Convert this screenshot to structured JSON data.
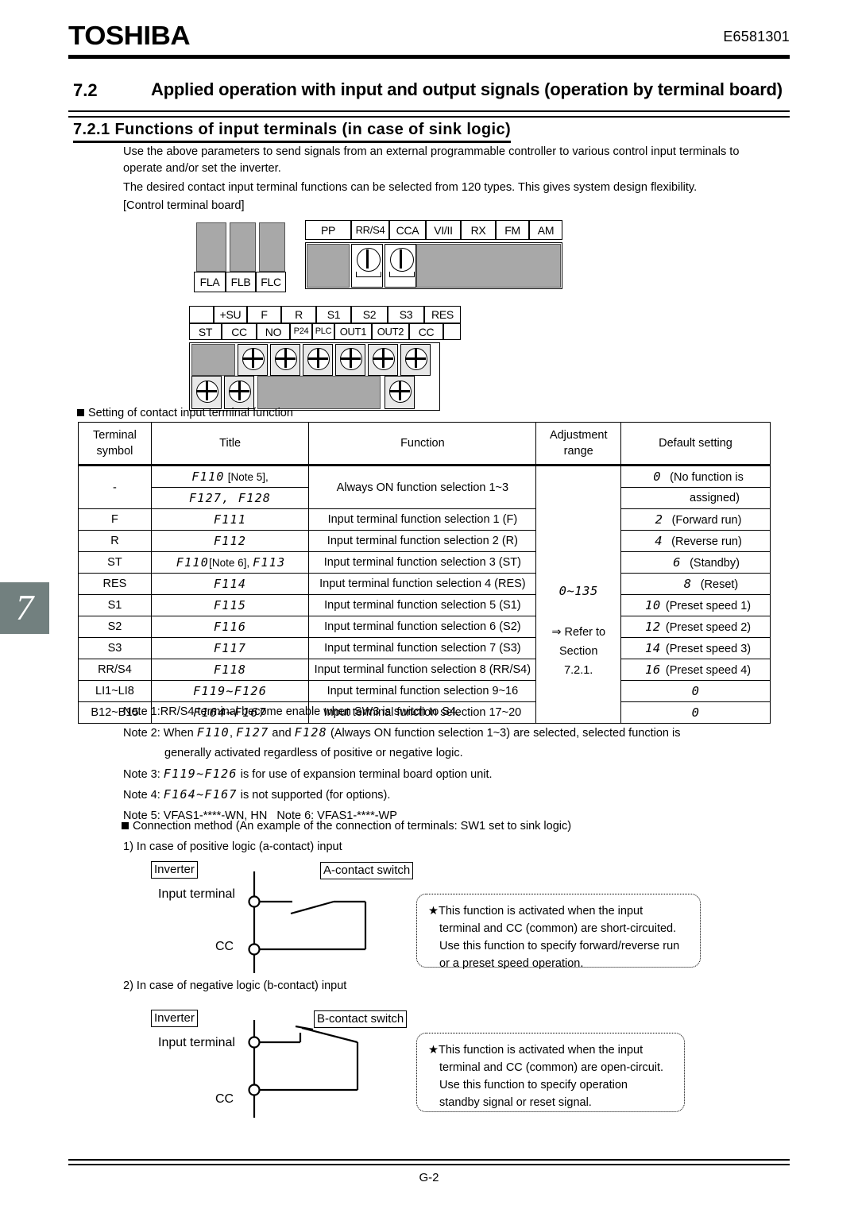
{
  "header": {
    "brand": "TOSHIBA",
    "doc_code": "E6581301"
  },
  "section": {
    "number": "7.2",
    "title": "Applied operation with input and output signals (operation by terminal board)",
    "subsection": "7.2.1  Functions of input terminals (in case of sink logic)"
  },
  "intro": {
    "p1": "Use the above parameters to send signals from an external programmable controller to various control input terminals to operate and/or set the inverter.",
    "p2": "The desired contact input terminal functions can be selected from 120 types. This gives system design flexibility.",
    "p3": "[Control terminal board]"
  },
  "chapter_thumb": "7",
  "terminal_board": {
    "relay_labels": [
      "FLA",
      "FLB",
      "FLC"
    ],
    "top_row_labels": [
      "PP",
      "RR/S4",
      "CCA",
      "VI/II",
      "RX",
      "FM",
      "AM"
    ],
    "mid_row_labels": [
      "",
      "+SU",
      "F",
      "R",
      "S1",
      "S2",
      "S3",
      "RES"
    ],
    "bottom_row_labels": [
      "ST",
      "CC",
      "NO",
      "P24",
      "PLC",
      "OUT1",
      "OUT2",
      "CC",
      ""
    ]
  },
  "table": {
    "caption": "Setting of contact input terminal function",
    "columns": {
      "symbol": [
        "Terminal",
        "symbol"
      ],
      "title": "Title",
      "function": "Function",
      "adjustment": [
        "Adjustment",
        "range"
      ],
      "default": "Default setting"
    },
    "adjust_range": {
      "range": "0~135",
      "refer": "⇒ Refer to",
      "section_word": "Section",
      "section_num": "7.2.1."
    },
    "rows": [
      {
        "symbol": "-",
        "title_line1": "F110",
        "title_note1": "[Note 5],",
        "title_line2": "F127, F128",
        "function": "Always ON function selection 1~3",
        "default_val": "0",
        "default_text": "(No function is",
        "default_text2": "assigned)"
      },
      {
        "symbol": "F",
        "title_line1": "F111",
        "function": "Input terminal function selection 1 (F)",
        "default_val": "2",
        "default_text": "(Forward run)"
      },
      {
        "symbol": "R",
        "title_line1": "F112",
        "function": "Input terminal function selection 2 (R)",
        "default_val": "4",
        "default_text": "(Reverse run)"
      },
      {
        "symbol": "ST",
        "title_line1": "F110",
        "title_note1": "[Note 6],",
        "title_extra": "F113",
        "function": "Input terminal function selection 3 (ST)",
        "default_val": "6",
        "default_text": "(Standby)"
      },
      {
        "symbol": "RES",
        "title_line1": "F114",
        "function": "Input terminal function selection 4 (RES)",
        "default_val": "8",
        "default_text": "(Reset)"
      },
      {
        "symbol": "S1",
        "title_line1": "F115",
        "function": "Input terminal function selection 5 (S1)",
        "default_val": "10",
        "default_text": "(Preset speed 1)"
      },
      {
        "symbol": "S2",
        "title_line1": "F116",
        "function": "Input terminal function selection 6 (S2)",
        "default_val": "12",
        "default_text": "(Preset speed 2)"
      },
      {
        "symbol": "S3",
        "title_line1": "F117",
        "function": "Input terminal function selection 7 (S3)",
        "default_val": "14",
        "default_text": "(Preset speed 3)"
      },
      {
        "symbol": "RR/S4",
        "title_line1": "F118",
        "function": "Input terminal function selection 8 (RR/S4)",
        "default_val": "16",
        "default_text": "(Preset speed 4)"
      },
      {
        "symbol": "LI1~LI8",
        "title_line1": "F119~F126",
        "function": "Input terminal function selection 9~16",
        "default_val": "0",
        "default_text": ""
      },
      {
        "symbol": "B12~B15",
        "title_line1": "F164~F167",
        "function": "Input terminal function selection 17~20",
        "default_val": "0",
        "default_text": ""
      }
    ]
  },
  "notes": {
    "n1": "Note 1:RR/S4 terminal become enable when SW3 is switch to S4.",
    "n2_a": "Note 2: When ",
    "n2_code1": "F110",
    "n2_b": ", ",
    "n2_code2": "F127",
    "n2_c": " and ",
    "n2_code3": "F128",
    "n2_d": " (Always ON function selection 1~3) are selected, selected function is",
    "n2_cont": "generally activated regardless of positive or negative logic.",
    "n3_a": "Note 3: ",
    "n3_code": "F119~F126",
    "n3_b": " is for use of expansion terminal board option unit.",
    "n4_a": "Note 4: ",
    "n4_code": "F164~F167",
    "n4_b": " is not supported (for options).",
    "n5": "Note 5: VFAS1-****-WN, HN",
    "n6": "Note 6: VFAS1-****-WP"
  },
  "connection": {
    "heading": "Connection method (An example of the connection of terminals: SW1 set to sink logic)",
    "case1_title": "1) In case of positive logic (a-contact) input",
    "case2_title": "2) In case of negative logic (b-contact) input",
    "inverter_label": "Inverter",
    "a_switch_label": "A-contact switch",
    "b_switch_label": "B-contact switch",
    "input_terminal_label": "Input terminal",
    "cc_label": "CC",
    "callout1": {
      "line1": "★This function is activated when the input",
      "line2": "terminal and CC (common) are short-circuited.",
      "line3": "Use this function to specify forward/reverse run",
      "line4": "or a preset speed operation."
    },
    "callout2": {
      "line1": "★This function is activated when the input",
      "line2": "terminal and CC (common) are open-circuit.",
      "line3": "Use this function to specify operation",
      "line4": "standby signal or reset signal."
    }
  },
  "footer": {
    "page": "G-2"
  }
}
